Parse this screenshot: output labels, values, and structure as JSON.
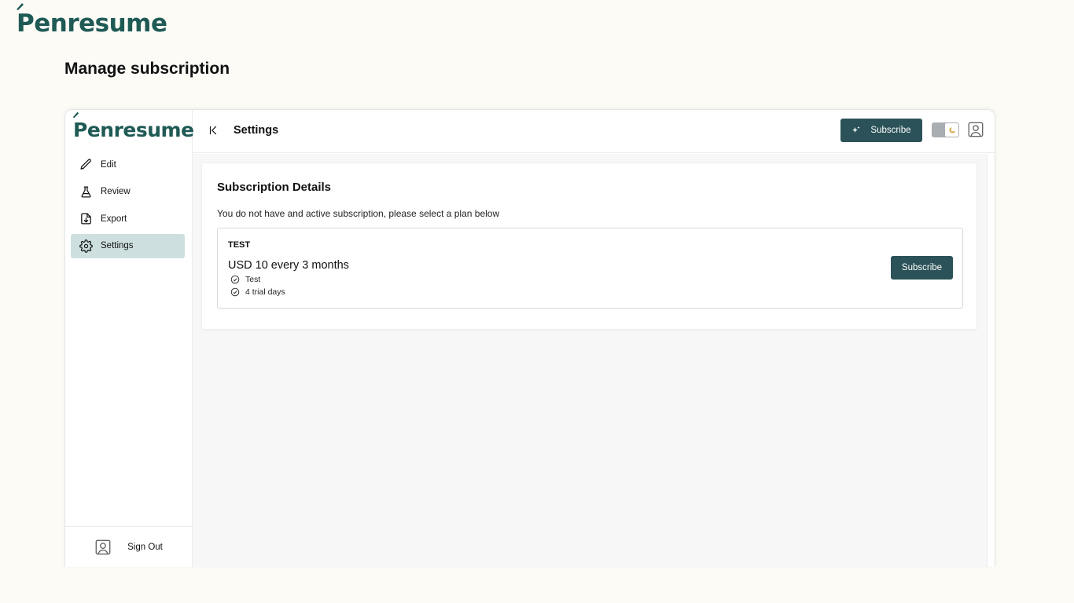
{
  "brand": {
    "name_lead": "P",
    "name_rest": "enresume"
  },
  "page": {
    "title": "Manage subscription"
  },
  "sidebar": {
    "items": [
      {
        "label": "Edit",
        "icon": "pencil-icon"
      },
      {
        "label": "Review",
        "icon": "flask-icon"
      },
      {
        "label": "Export",
        "icon": "file-download-icon"
      },
      {
        "label": "Settings",
        "icon": "gear-icon",
        "active": true
      }
    ],
    "signout_label": "Sign Out"
  },
  "topbar": {
    "title": "Settings",
    "subscribe_label": "Subscribe"
  },
  "subscription": {
    "title": "Subscription Details",
    "description": "You do not have and active subscription, please select a plan below",
    "plan": {
      "name": "TEST",
      "price": "USD 10 every 3 months",
      "features": [
        "Test",
        "4 trial days"
      ],
      "button_label": "Subscribe"
    }
  },
  "colors": {
    "brand": "#1f5a55",
    "button": "#2b5258",
    "active_nav": "#cde0df",
    "page_bg": "#fcfbf6"
  }
}
